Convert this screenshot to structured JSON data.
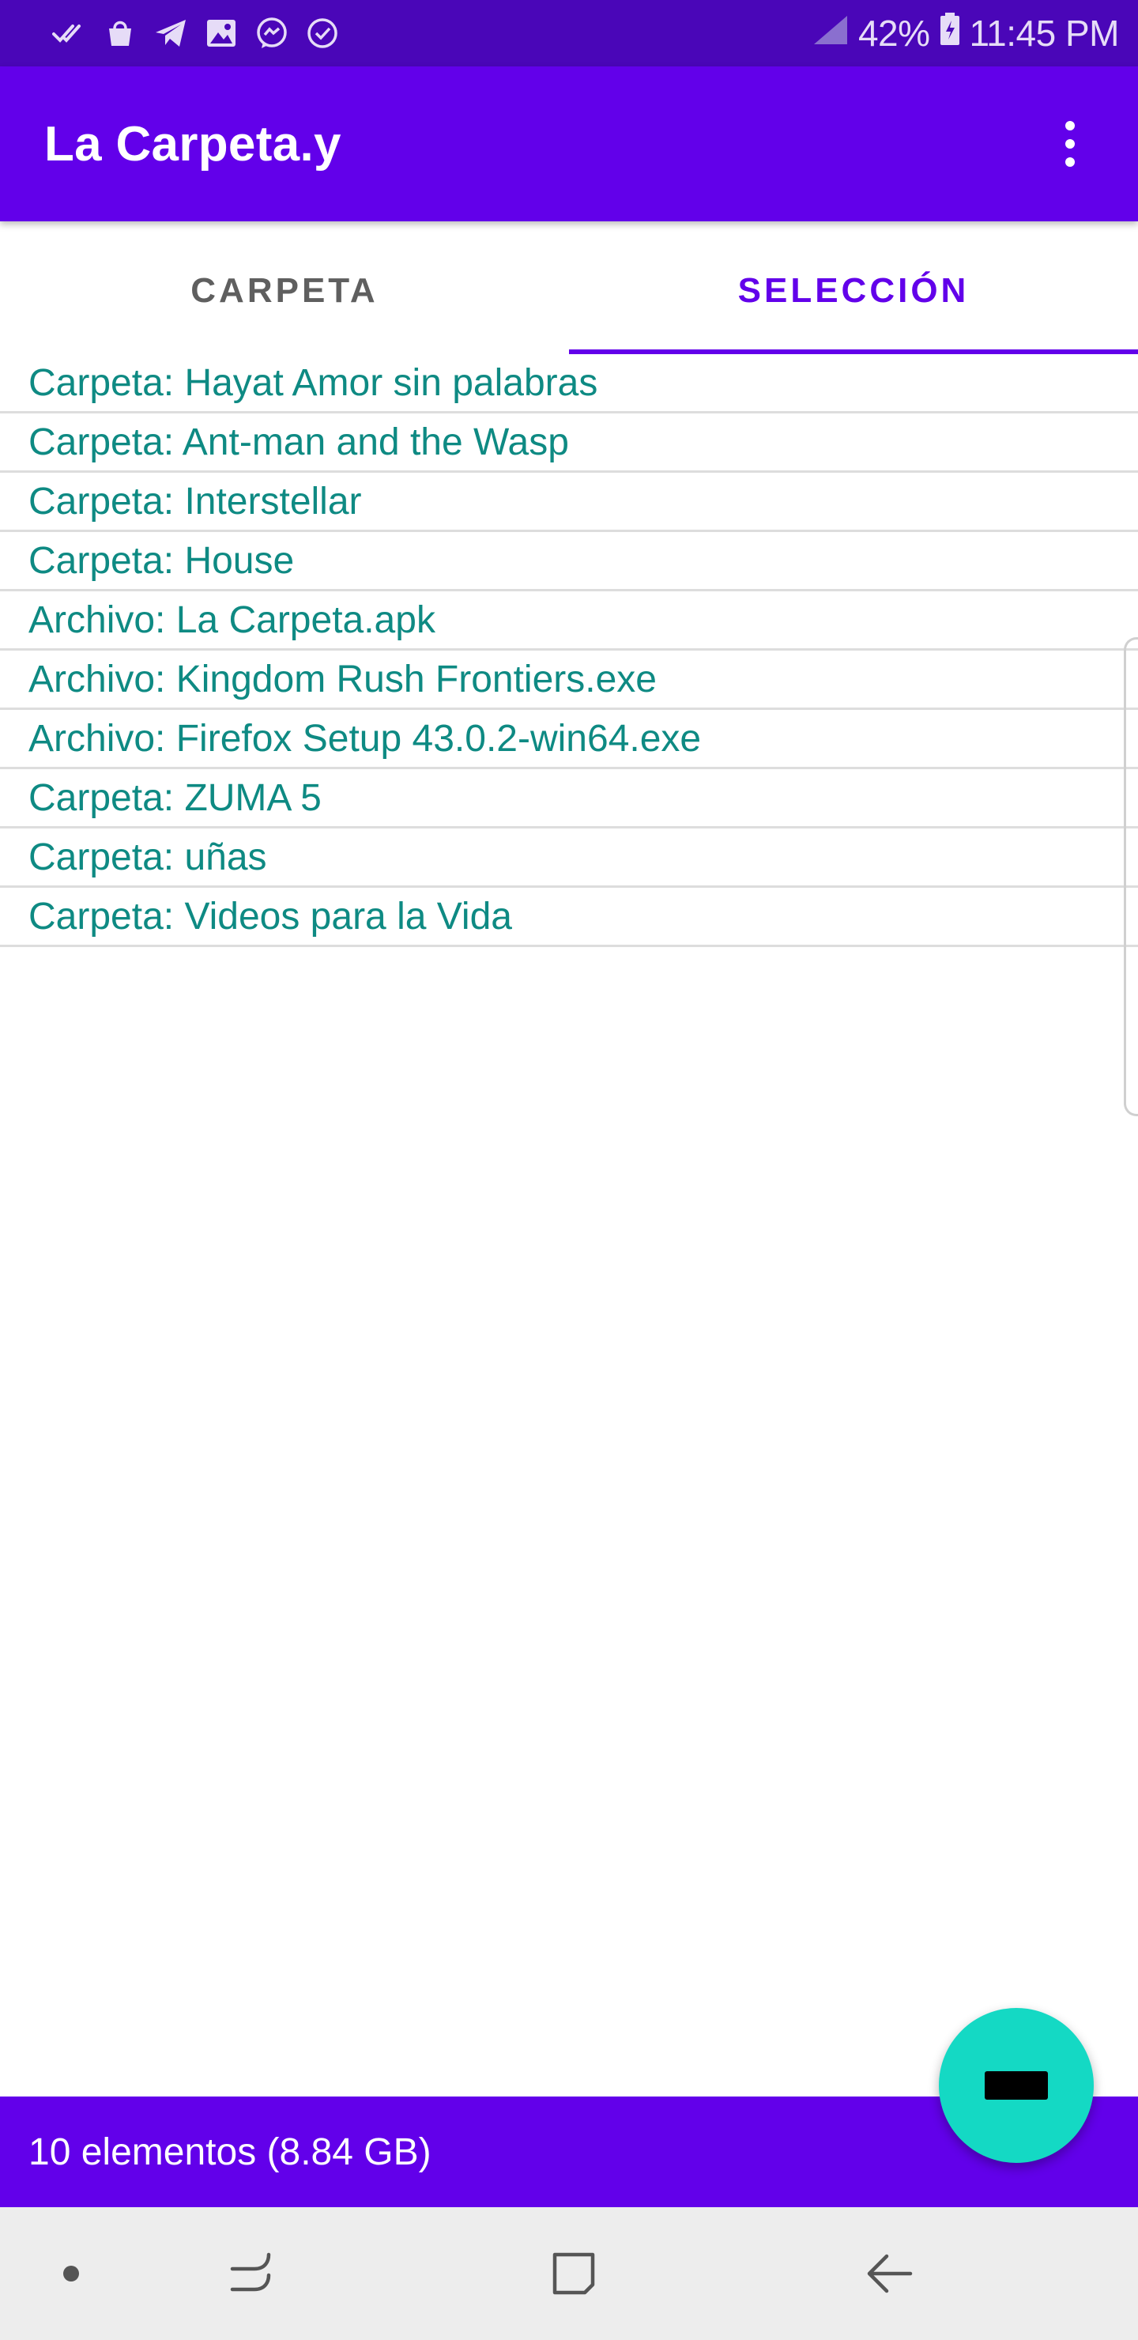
{
  "status_bar": {
    "battery": "42%",
    "time": "11:45 PM",
    "icons": [
      "double-check-icon",
      "shopping-bag-icon",
      "telegram-icon",
      "image-icon",
      "messenger-icon",
      "check-circle-icon"
    ]
  },
  "app_bar": {
    "title": "La Carpeta.y",
    "menu_icon": "more-vert-icon"
  },
  "tabs": [
    {
      "label": "CARPETA",
      "active": false
    },
    {
      "label": "SELECCIÓN",
      "active": true
    }
  ],
  "items": [
    "Carpeta: Hayat Amor sin palabras",
    "Carpeta: Ant-man and the Wasp",
    "Carpeta: Interstellar",
    "Carpeta: House",
    "Archivo: La Carpeta.apk",
    "Archivo: Kingdom Rush Frontiers.exe",
    "Archivo: Firefox Setup 43.0.2-win64.exe",
    "Carpeta: ZUMA 5",
    "Carpeta: uñas",
    "Carpeta: Videos para la Vida"
  ],
  "footer": {
    "summary": "10 elementos (8.84 GB)"
  },
  "fab": {
    "icon": "minus-icon"
  },
  "nav_bar": {
    "icons": [
      "dot-icon",
      "recent-apps-icon",
      "home-icon",
      "back-icon"
    ]
  },
  "colors": {
    "status_bar": "#4a06b8",
    "primary": "#6200ea",
    "item_text": "#0e8a83",
    "fab": "#14d9c4",
    "nav_bar": "#ededed"
  }
}
